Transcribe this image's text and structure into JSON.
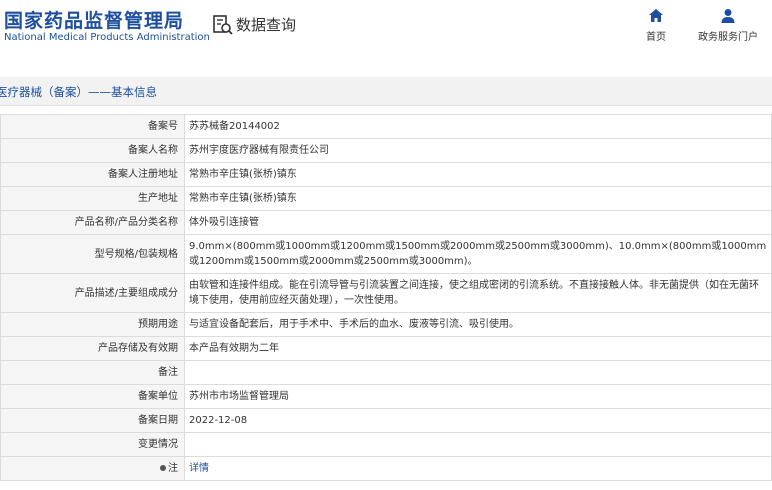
{
  "header": {
    "brand_cn": "国家药品监督管理局",
    "brand_en": "National Medical Products Administration",
    "section_title": "数据查询",
    "nav": [
      {
        "label": "首页",
        "icon": "home-icon"
      },
      {
        "label": "政务服务门户",
        "icon": "user-icon"
      }
    ]
  },
  "breadcrumb": "医疗器械（备案）——基本信息",
  "colors": {
    "brand_blue": "#1d4f9e",
    "breadcrumb_bg": "#f2f2f2",
    "label_bg": "#f5f5f5",
    "border": "#dcdcdc"
  },
  "record": {
    "rows": [
      {
        "label": "备案号",
        "value": "苏苏械备20144002"
      },
      {
        "label": "备案人名称",
        "value": "苏州宇度医疗器械有限责任公司"
      },
      {
        "label": "备案人注册地址",
        "value": "常熟市辛庄镇(张桥)镇东"
      },
      {
        "label": "生产地址",
        "value": "常熟市辛庄镇(张桥)镇东"
      },
      {
        "label": "产品名称/产品分类名称",
        "value": "体外吸引连接管"
      },
      {
        "label": "型号规格/包装规格",
        "value": "9.0mm×(800mm或1000mm或1200mm或1500mm或2000mm或2500mm或3000mm)、10.0mm×(800mm或1000mm或1200mm或1500mm或2000mm或2500mm或3000mm)。"
      },
      {
        "label": "产品描述/主要组成成分",
        "value": "由软管和连接件组成。能在引流导管与引流装置之间连接，使之组成密闭的引流系统。不直接接触人体。非无菌提供（如在无菌环境下使用，使用前应经灭菌处理），一次性使用。"
      },
      {
        "label": "预期用途",
        "value": "与适宜设备配套后，用于手术中、手术后的血水、废液等引流、吸引使用。"
      },
      {
        "label": "产品存储及有效期",
        "value": "本产品有效期为二年"
      },
      {
        "label": "备注",
        "value": ""
      },
      {
        "label": "备案单位",
        "value": "苏州市市场监督管理局"
      },
      {
        "label": "备案日期",
        "value": "2022-12-08"
      },
      {
        "label": "变更情况",
        "value": ""
      }
    ],
    "note_row": {
      "label": "注",
      "link_text": "详情"
    }
  }
}
